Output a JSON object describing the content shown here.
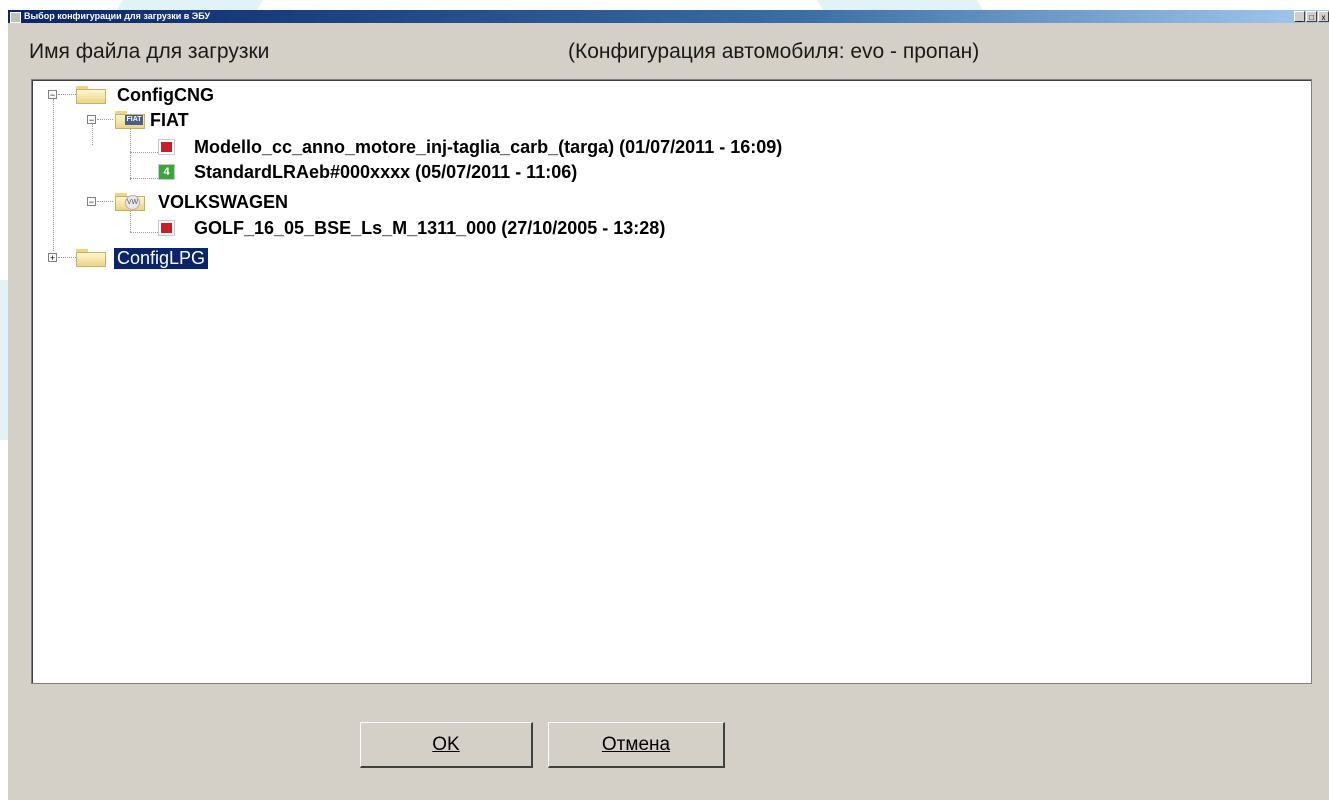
{
  "window": {
    "title": "Выбор конфигурации для загрузки в ЭБУ",
    "controls": [
      "_",
      "□",
      "x"
    ]
  },
  "header": {
    "file_label": "Имя файла для загрузки",
    "config_label": "(Конфигурация автомобиля: evo - пропан)"
  },
  "tree": {
    "root1": {
      "label": "ConfigCNG",
      "expander": "−"
    },
    "fiat": {
      "label": "FIAT",
      "expander": "−",
      "badge": "FIAT"
    },
    "fiat_file1": {
      "label": "Modello_cc_anno_motore_inj-taglia_carb_(targa) (01/07/2011 - 16:09)"
    },
    "fiat_file2": {
      "label": "StandardLRAeb#000xxxx (05/07/2011 - 11:06)",
      "badge": "4"
    },
    "vw": {
      "label": "VOLKSWAGEN",
      "expander": "−",
      "badge": "VW"
    },
    "vw_file1": {
      "label": "GOLF_16_05_BSE_Ls_M_1311_000 (27/10/2005 - 13:28)"
    },
    "root2": {
      "label": "ConfigLPG",
      "expander": "+",
      "selected": true
    }
  },
  "buttons": {
    "ok": "OK",
    "cancel": "Отмена"
  },
  "colors": {
    "selection": "#0a246a",
    "dialog_bg": "#d4d0c8",
    "titlebar": "#0a246a"
  }
}
